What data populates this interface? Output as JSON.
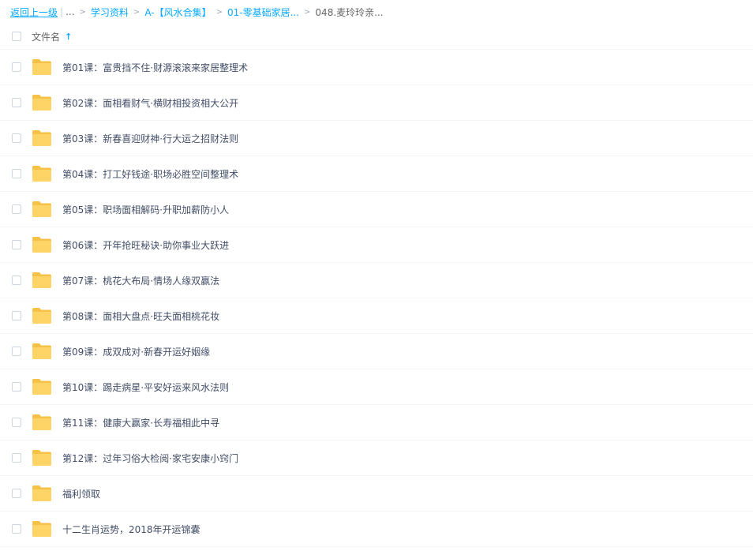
{
  "breadcrumb": {
    "back": "返回上一级",
    "separator": "|",
    "ellipsis": "...",
    "items": [
      "学习资料",
      "A-【风水合集】",
      "01-零基础家居..."
    ],
    "current": "048.麦玲玲亲..."
  },
  "list_header": {
    "column_label": "文件名",
    "sort_icon": "arrow-up-icon"
  },
  "files": [
    "第01课：富贵挡不住·财源滚滚来家居整理术",
    "第02课：面相看财气·横财相投资相大公开",
    "第03课：新春喜迎财神·行大运之招财法则",
    "第04课：打工好钱途·职场必胜空间整理术",
    "第05课：职场面相解码·升职加薪防小人",
    "第06课：开年抢旺秘诀·助你事业大跃进",
    "第07课：桃花大布局·情场人缘双赢法",
    "第08课：面相大盘点·旺夫面相桃花妆",
    "第09课：成双成对·新春开运好姻缘",
    "第10课：踢走病星·平安好运来风水法则",
    "第11课：健康大赢家·长寿福相此中寻",
    "第12课：过年习俗大检阅·家宅安康小窍门",
    "福利领取",
    "十二生肖运势，2018年开运锦囊"
  ],
  "colors": {
    "link": "#09aaff",
    "folder": "#ffd466",
    "folder_tab": "#f5c247",
    "text": "#424e67",
    "divider": "#f2f4f7"
  }
}
